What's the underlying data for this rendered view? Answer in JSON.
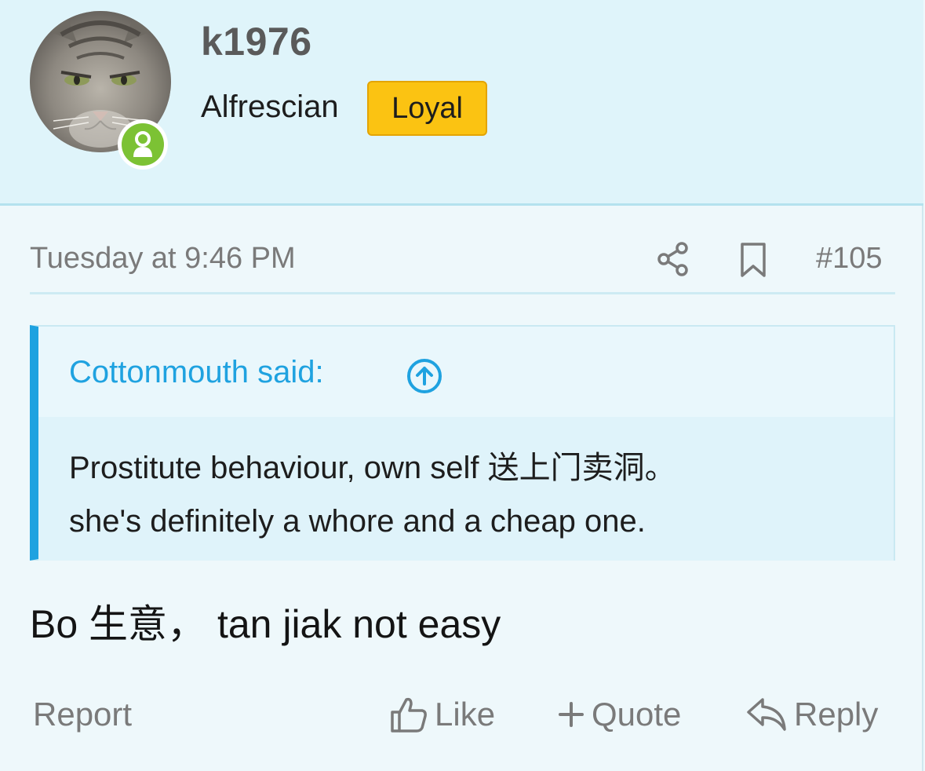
{
  "user": {
    "name": "k1976",
    "title": "Alfrescian",
    "banner": "Loyal",
    "avatar_icon": "cat-avatar",
    "online_icon": "user-online-icon"
  },
  "post": {
    "date": "Tuesday at 9:46 PM",
    "number": "#105",
    "share_icon": "share-icon",
    "bookmark_icon": "bookmark-icon"
  },
  "quote": {
    "author": "Cottonmouth said:",
    "jump_icon": "arrow-up-circle-icon",
    "lines": [
      "Prostitute behaviour, own self 送上门卖洞。",
      "she's definitely a whore and a cheap one."
    ]
  },
  "message": "Bo 生意， tan jiak not easy",
  "footer": {
    "report": "Report",
    "like": "Like",
    "quote": "Quote",
    "reply": "Reply"
  },
  "colors": {
    "header_bg": "#dff4fa",
    "accent_blue": "#1fa2e0",
    "banner_yellow": "#fbc312",
    "online_green": "#7cc234",
    "muted_text": "#7a7a7a"
  }
}
